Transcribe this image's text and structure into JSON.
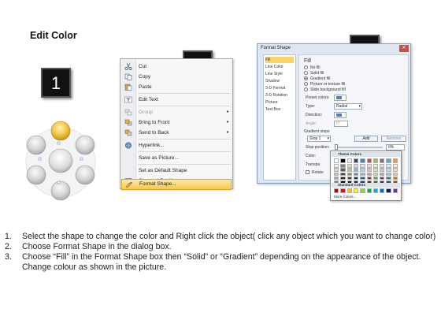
{
  "title": "Edit Color",
  "steps": [
    {
      "number": "1"
    },
    {
      "number": "2"
    },
    {
      "number": "3"
    }
  ],
  "context_menu": {
    "items": [
      {
        "label": "Cut",
        "icon": "scissors-icon",
        "disabled": false,
        "submenu": false
      },
      {
        "label": "Copy",
        "icon": "copy-icon",
        "disabled": false,
        "submenu": false
      },
      {
        "label": "Paste",
        "icon": "paste-icon",
        "disabled": false,
        "submenu": false
      },
      {
        "label": "Edit Text",
        "icon": "edit-text-icon",
        "disabled": false,
        "submenu": false
      },
      {
        "label": "Group",
        "icon": "group-icon",
        "disabled": true,
        "submenu": true
      },
      {
        "label": "Bring to Front",
        "icon": "bring-front-icon",
        "disabled": false,
        "submenu": true
      },
      {
        "label": "Send to Back",
        "icon": "send-back-icon",
        "disabled": false,
        "submenu": true
      },
      {
        "label": "Hyperlink...",
        "icon": "hyperlink-icon",
        "disabled": false,
        "submenu": false
      },
      {
        "label": "Save as Picture...",
        "icon": "",
        "disabled": false,
        "submenu": false
      },
      {
        "label": "Set as Default Shape",
        "icon": "",
        "disabled": false,
        "submenu": false
      },
      {
        "label": "Size and Position...",
        "icon": "size-position-icon",
        "disabled": false,
        "submenu": false
      },
      {
        "label": "Format Shape...",
        "icon": "format-shape-icon",
        "disabled": false,
        "submenu": false,
        "highlighted": true
      }
    ]
  },
  "format_dialog": {
    "title": "Format Shape",
    "nav": [
      "Fill",
      "Line Color",
      "Line Style",
      "Shadow",
      "3-D Format",
      "3-D Rotation",
      "Picture",
      "Text Box"
    ],
    "selected_nav": "Fill",
    "section_title": "Fill",
    "fill_options": [
      {
        "label": "No fill",
        "selected": false
      },
      {
        "label": "Solid fill",
        "selected": false
      },
      {
        "label": "Gradient fill",
        "selected": true
      },
      {
        "label": "Picture or texture fill",
        "selected": false
      },
      {
        "label": "Slide background fill",
        "selected": false
      }
    ],
    "preset_colors_label": "Preset colors:",
    "type_label": "Type:",
    "type_value": "Radial",
    "direction_label": "Direction:",
    "angle_label": "Angle:",
    "angle_value": "0°",
    "gradient_stops_label": "Gradient stops",
    "stop_value": "Stop 1",
    "add_button": "Add",
    "remove_button": "Remove",
    "stop_position_label": "Stop position:",
    "stop_position_value": "0%",
    "color_label": "Color:",
    "transparency_label": "Transpa",
    "rotate_label": "Rotate"
  },
  "palette": {
    "theme_label": "Theme Colors",
    "standard_label": "Standard Colors",
    "more_label": "More Colors...",
    "theme_top_row": [
      "#ffffff",
      "#000000",
      "#eeece1",
      "#1f497d",
      "#4f81bd",
      "#c0504d",
      "#9bbb59",
      "#8064a2",
      "#4bacc6",
      "#f79646"
    ],
    "theme_tints": [
      [
        "#f2f2f2",
        "#7f7f7f",
        "#ddd9c3",
        "#c6d9f0",
        "#dbe5f1",
        "#f2dcdb",
        "#ebf1dd",
        "#e5e0ec",
        "#dbeef3",
        "#fdeada"
      ],
      [
        "#d8d8d8",
        "#595959",
        "#c4bd97",
        "#8db3e2",
        "#b8cce4",
        "#e5b9b7",
        "#d7e3bc",
        "#ccc1d9",
        "#b7dde8",
        "#fbd5b5"
      ],
      [
        "#bfbfbf",
        "#3f3f3f",
        "#938953",
        "#548dd4",
        "#95b3d7",
        "#d99694",
        "#c3d69b",
        "#b2a2c7",
        "#92cddc",
        "#fac08f"
      ],
      [
        "#a5a5a5",
        "#262626",
        "#494429",
        "#17365d",
        "#366092",
        "#953734",
        "#76923c",
        "#5f497a",
        "#31859b",
        "#e36c09"
      ],
      [
        "#7f7f7f",
        "#0c0c0c",
        "#1d1b10",
        "#0f243e",
        "#244061",
        "#632423",
        "#4f6128",
        "#3f3151",
        "#205867",
        "#974806"
      ]
    ],
    "standard": [
      "#c00000",
      "#ff0000",
      "#ffc000",
      "#ffff00",
      "#92d050",
      "#00b050",
      "#00b0f0",
      "#0070c0",
      "#002060",
      "#7030a0"
    ]
  },
  "instructions": [
    {
      "num": "1.",
      "text": "Select the shape to change the color and Right click the object( click any object which you want to change color)"
    },
    {
      "num": "2.",
      "text": "Choose Format Shape in the dialog box."
    },
    {
      "num": "3.",
      "text": "Choose “Fill” in the Format Shape box then “Solid” or “Gradient” depending on the appearance of the object. Change colour as shown in the picture."
    }
  ]
}
